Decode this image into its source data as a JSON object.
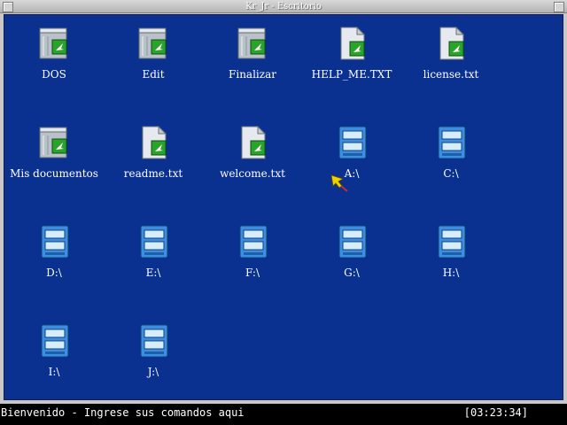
{
  "window": {
    "title": "Kr_Jr - Escritorio"
  },
  "colors": {
    "desktop_bg": "#0a318f",
    "statusbar_bg": "#000000",
    "text": "#ffffff",
    "title_bg": "#c8c8c8",
    "file_green": "#2a9a2a",
    "drive_blue": "#3c8ee0"
  },
  "icons": [
    {
      "label": "DOS",
      "icon": "program-icon"
    },
    {
      "label": "Edit",
      "icon": "program-icon"
    },
    {
      "label": "Finalizar",
      "icon": "program-icon"
    },
    {
      "label": "HELP_ME.TXT",
      "icon": "text-file-icon"
    },
    {
      "label": "license.txt",
      "icon": "text-file-icon"
    },
    {
      "label": "Mis documentos",
      "icon": "program-icon"
    },
    {
      "label": "readme.txt",
      "icon": "text-file-icon"
    },
    {
      "label": "welcome.txt",
      "icon": "text-file-icon"
    },
    {
      "label": "A:\\",
      "icon": "drive-icon"
    },
    {
      "label": "C:\\",
      "icon": "drive-icon"
    },
    {
      "label": "D:\\",
      "icon": "drive-icon"
    },
    {
      "label": "E:\\",
      "icon": "drive-icon"
    },
    {
      "label": "F:\\",
      "icon": "drive-icon"
    },
    {
      "label": "G:\\",
      "icon": "drive-icon"
    },
    {
      "label": "H:\\",
      "icon": "drive-icon"
    },
    {
      "label": "I:\\",
      "icon": "drive-icon"
    },
    {
      "label": "J:\\",
      "icon": "drive-icon"
    }
  ],
  "statusbar": {
    "message": "Bienvenido - Ingrese sus comandos aqui",
    "clock": "[03:23:34]"
  }
}
